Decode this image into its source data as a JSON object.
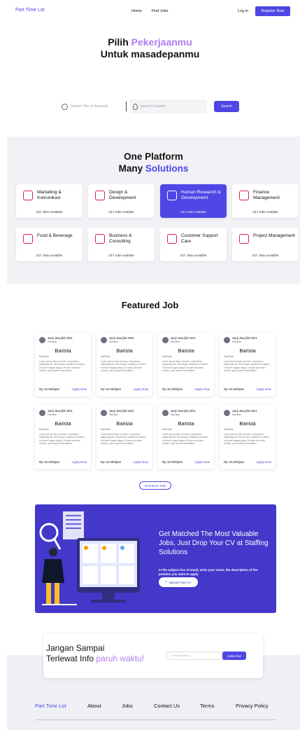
{
  "nav": {
    "brand": "Part Time Lot",
    "links": [
      "Home",
      "Find Jobs"
    ],
    "login": "Log in",
    "register": "Register Now"
  },
  "hero": {
    "line1_prefix": "Pilih ",
    "line1_accent": "Pekerjaanmu",
    "line2": "Untuk masadepanmu"
  },
  "search": {
    "keyword_placeholder": "Search Title or Keyword",
    "location_placeholder": "Search Location",
    "button": "Search"
  },
  "platform": {
    "title_line1": "One Platform",
    "title_prefix": "Many ",
    "title_accent": "Solutions",
    "categories": [
      {
        "name": "Marketing & Komunikasi",
        "jobs": "237 Jobs Available",
        "icon": "megaphone-icon"
      },
      {
        "name": "Design & Development",
        "jobs": "237 Jobs Availabe",
        "icon": "design-icon"
      },
      {
        "name": "Human Research & Development",
        "jobs": "237 Jobs Availabe",
        "icon": "id-card-icon"
      },
      {
        "name": "Finance Management",
        "jobs": "237 Jobs Availabe",
        "icon": "finance-icon"
      },
      {
        "name": "Food & Beverage",
        "jobs": "237 Jobs Available",
        "icon": "food-icon"
      },
      {
        "name": "Business & Consulting",
        "jobs": "237 Jobs Availabe",
        "icon": "handshake-icon"
      },
      {
        "name": "Customer Support Care",
        "jobs": "237 Jobs Available",
        "icon": "headset-icon"
      },
      {
        "name": "Project Management",
        "jobs": "237 Jobs Available",
        "icon": "clipboard-icon"
      }
    ]
  },
  "featured": {
    "title": "Featured Job",
    "jobs": [
      {
        "date": "Janji Jiwa jilid 2021",
        "type": "Part time",
        "role": "Barista",
        "employment": "Part Time",
        "desc": "Lorem ipsum dolor sit amet, consectetur adipiscing elit. Sed tempor incididunt ut labore et dolore magna aliqua. Ut enim ad minim veniam, quis nostrud exercitation.",
        "pay": "Rp 10.000/jam",
        "apply": "Apply Now"
      },
      {
        "date": "Janji Jiwa jilid 2021",
        "type": "Part time",
        "role": "Barista",
        "employment": "Part Time",
        "desc": "Lorem ipsum dolor sit amet, consectetur adipiscing elit. Sed tempor incididunt ut labore et dolore magna aliqua. Ut enim ad minim veniam, quis nostrud exercitation.",
        "pay": "Rp 10.000/jam",
        "apply": "Apply Now"
      },
      {
        "date": "Janji Jiwa jilid 2021",
        "type": "Part time",
        "role": "Barista",
        "employment": "Part Time",
        "desc": "Lorem ipsum dolor sit amet, consectetur adipiscing elit. Sed tempor incididunt ut labore et dolore magna aliqua. Ut enim ad minim veniam, quis nostrud exercitation.",
        "pay": "Rp 10.000/jam",
        "apply": "Apply Now"
      },
      {
        "date": "Janji Jiwa jilid 2021",
        "type": "Part time",
        "role": "Barista",
        "employment": "Part Time",
        "desc": "Lorem ipsum dolor sit amet, consectetur adipiscing elit. Sed tempor incididunt ut labore et dolore magna aliqua. Ut enim ad minim veniam, quis nostrud exercitation.",
        "pay": "Rp 10.000/jam",
        "apply": "Apply Now"
      },
      {
        "date": "Janji Jiwa jilid 2021",
        "type": "Part time",
        "role": "Barista",
        "employment": "Part Time",
        "desc": "Lorem ipsum dolor sit amet, consectetur adipiscing elit. Sed tempor incididunt ut labore et dolore magna aliqua. Ut enim ad minim veniam, quis nostrud exercitation.",
        "pay": "Rp 10.000/jam",
        "apply": "Apply Now"
      },
      {
        "date": "Janji Jiwa jilid 2021",
        "type": "Part time",
        "role": "Barista",
        "employment": "Part Time",
        "desc": "Lorem ipsum dolor sit amet, consectetur adipiscing elit. Sed tempor incididunt ut labore et dolore magna aliqua. Ut enim ad minim veniam, quis nostrud exercitation.",
        "pay": "Rp 10.000/jam",
        "apply": "Apply Now"
      },
      {
        "date": "Janji Jiwa jilid 2021",
        "type": "Part time",
        "role": "Barista",
        "employment": "Part Time",
        "desc": "Lorem ipsum dolor sit amet, consectetur adipiscing elit. Sed tempor incididunt ut labore et dolore magna aliqua. Ut enim ad minim veniam, quis nostrud exercitation.",
        "pay": "Rp 10.000/jam",
        "apply": "Apply Now"
      },
      {
        "date": "Janji Jiwa jilid 2021",
        "type": "Part time",
        "role": "Barista",
        "employment": "Part Time",
        "desc": "Lorem ipsum dolor sit amet, consectetur adipiscing elit. Sed tempor incididunt ut labore et dolore magna aliqua. Ut enim ad minim veniam, quis nostrud exercitation.",
        "pay": "Rp 10.000/jam",
        "apply": "Apply Now"
      }
    ],
    "find_more": "Find More Jobs"
  },
  "banner": {
    "heading": "Get Matched The Most Valuable Jobs, Just Drop Your CV at Staffing Solutions",
    "subtext": "In the subject line of email, write your name, the description of the position you want to apply",
    "button": "Upload Your CV"
  },
  "newsletter": {
    "line1": "Jangan Sampai",
    "line2_prefix": "Terlewat Info ",
    "line2_accent": "paruh waktu!",
    "email_placeholder": "Email address",
    "button": "Subscribe"
  },
  "footer": {
    "brand": "Part Time Lot",
    "links": [
      "About",
      "Jobs",
      "Contact Us",
      "Terms",
      "Privacy Policy"
    ]
  },
  "colors": {
    "primary": "#4f46e5",
    "accent_purple": "#b07cf0",
    "banner_bg": "#4338ca",
    "section_bg": "#f1f1f6"
  }
}
